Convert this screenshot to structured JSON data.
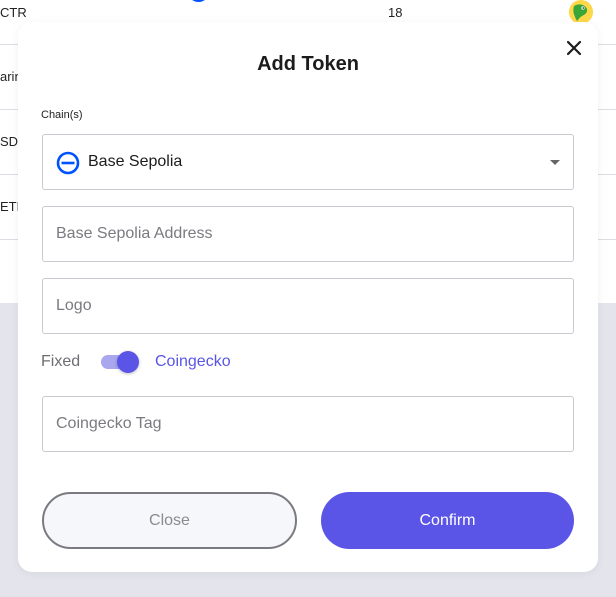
{
  "background_table": {
    "rows": [
      {
        "name": "CTR",
        "decimals": "18",
        "has_chain_icon": true,
        "has_logo": true
      },
      {
        "name": "arin",
        "decimals": "",
        "has_chain_icon": false,
        "has_logo": false
      },
      {
        "name": "SDC",
        "decimals": "",
        "has_chain_icon": false,
        "has_logo": false
      },
      {
        "name": "ETH",
        "decimals": "",
        "has_chain_icon": false,
        "has_logo": false
      }
    ]
  },
  "modal": {
    "title": "Add Token",
    "close_icon": "close-icon",
    "chain_label": "Chain(s)",
    "chain_value": "Base Sepolia",
    "chain_icon": "base-chain-icon",
    "address_placeholder": "Base Sepolia Address",
    "logo_placeholder": "Logo",
    "toggle": {
      "left_label": "Fixed",
      "right_label": "Coingecko",
      "checked": true
    },
    "coingecko_placeholder": "Coingecko Tag",
    "close_label": "Close",
    "confirm_label": "Confirm"
  },
  "colors": {
    "accent": "#5a55e6",
    "accent_light": "#a9a7ee",
    "chain_blue": "#0052ff",
    "backdrop": "#e4e5ec"
  }
}
